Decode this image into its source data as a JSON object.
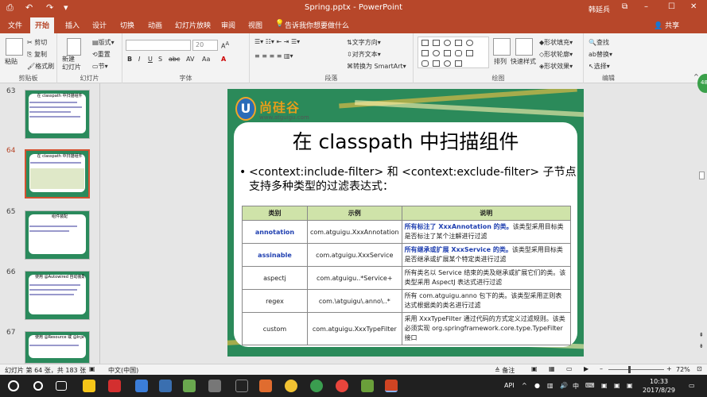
{
  "window": {
    "title": "Spring.pptx - PowerPoint",
    "user": "韩延兵",
    "buttons": [
      "⧉",
      "–",
      "☐",
      "✕"
    ],
    "qa_icons": [
      "⎙",
      "↶",
      "↷",
      "▾"
    ]
  },
  "tabs": [
    "文件",
    "开始",
    "插入",
    "设计",
    "切换",
    "动画",
    "幻灯片放映",
    "审阅",
    "视图"
  ],
  "tellme": "告诉我你想要做什么",
  "share": "共享",
  "ribbon": {
    "clipboard": {
      "label": "剪贴板",
      "paste": "粘贴",
      "cut": "剪切",
      "copy": "复制",
      "format_painter": "格式刷"
    },
    "slides": {
      "label": "幻灯片",
      "new_slide": "新建\n幻灯片",
      "layout": "版式",
      "reset": "重置",
      "section": "节"
    },
    "font": {
      "label": "字体",
      "font_size": "20",
      "buttons": [
        "B",
        "I",
        "U",
        "S",
        "abc",
        "AV",
        "Aa",
        "A"
      ]
    },
    "paragraph": {
      "label": "段落",
      "text_direction": "文字方向",
      "align_text": "对齐文本",
      "smartart": "转换为 SmartArt"
    },
    "drawing": {
      "label": "绘图",
      "arrange": "排列",
      "quick_styles": "快速样式",
      "shape_fill": "形状填充",
      "shape_outline": "形状轮廓",
      "shape_effects": "形状效果"
    },
    "editing": {
      "label": "编辑",
      "find": "查找",
      "replace": "替换",
      "select": "选择"
    }
  },
  "badge": "48",
  "thumbnails": [
    {
      "num": "63",
      "title": "在 classpath 中扫描组件"
    },
    {
      "num": "64",
      "title": "在 classpath 中扫描组件"
    },
    {
      "num": "65",
      "title": "组件装配"
    },
    {
      "num": "66",
      "title": "使用 @Autowired 自动装配 Bean"
    },
    {
      "num": "67",
      "title": "使用 @Resource 或 @Inject 自动装配 Bean"
    }
  ],
  "slide": {
    "logo_mark": "U",
    "logo_text": "尚硅谷",
    "logo_url": "www.atguigu.com",
    "title": "在 classpath 中扫描组件",
    "bullet": "<context:include-filter> 和 <context:exclude-filter> 子节点支持多种类型的过滤表达式：",
    "table": {
      "headers": [
        "类别",
        "示例",
        "说明"
      ],
      "rows": [
        {
          "cat": "annotation",
          "ex": "com.atguigu.XxxAnnotation",
          "desc_bold": "所有标注了 XxxAnnotation 的类。",
          "desc": "该类型采用目标类是否标注了某个注解进行过滤"
        },
        {
          "cat": "assinable",
          "ex": "com.atguigu.XxxService",
          "desc_bold": "所有继承或扩展 XxxService 的类。",
          "desc": "该类型采用目标类是否继承或扩展某个特定类进行过滤"
        },
        {
          "cat": "aspectj",
          "ex": "com.atguigu..*Service+",
          "desc_bold": "",
          "desc": "所有类名以 Service 结束的类及继承或扩展它们的类。该类型采用 AspectJ 表达式进行过滤"
        },
        {
          "cat": "regex",
          "ex": "com.\\atguigu\\.anno\\..*",
          "desc_bold": "",
          "desc": "所有 com.atguigu.anno 包下的类。该类型采用正则表达式根据类的类名进行过滤"
        },
        {
          "cat": "custom",
          "ex": "com.atguigu.XxxTypeFilter",
          "desc_bold": "",
          "desc": "采用 XxxTypeFilter 通过代码的方式定义过滤规则。该类必须实现 org.springframework.core.type.TypeFilter 接口"
        }
      ]
    }
  },
  "status": {
    "slide_info": "幻灯片 第 64 张，共 183 张",
    "language": "中文(中国)",
    "notes": "备注",
    "zoom": "72%"
  },
  "taskbar": {
    "ime": "中",
    "api": "API",
    "time": "10:33",
    "date": "2017/8/29"
  }
}
